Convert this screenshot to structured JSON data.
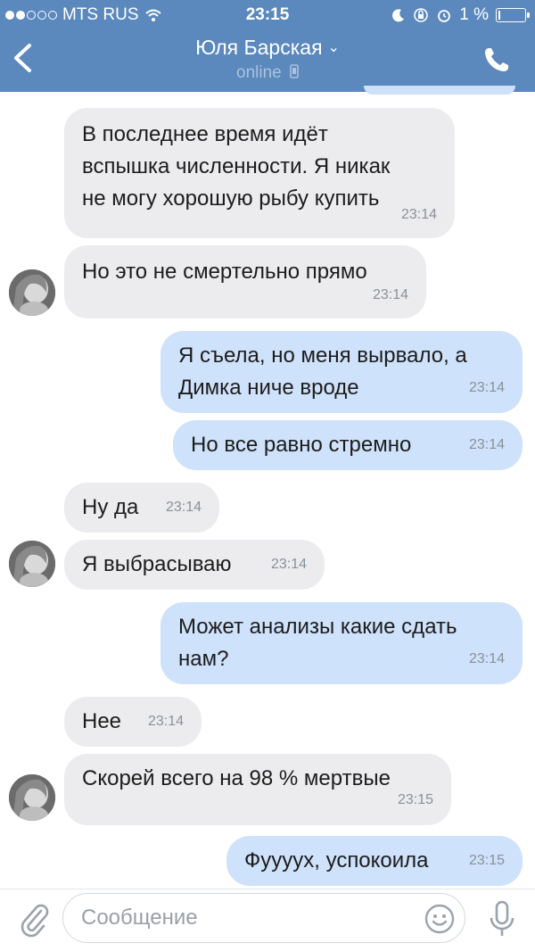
{
  "status_bar": {
    "carrier": "MTS RUS",
    "time": "23:15",
    "battery_text": "1 %"
  },
  "header": {
    "contact_name": "Юля Барская",
    "status": "online"
  },
  "messages": [
    {
      "dir": "in",
      "lines": [
        "В последнее время идёт",
        "вспышка численности. Я никак",
        "не могу хорошую рыбу купить"
      ],
      "time": "23:14",
      "avatar": false
    },
    {
      "dir": "in",
      "lines": [
        "Но это не смертельно прямо"
      ],
      "time": "23:14",
      "avatar": true
    },
    {
      "dir": "out",
      "lines": [
        "Я съела, но меня вырвало, а",
        "Димка ниче вроде"
      ],
      "time": "23:14"
    },
    {
      "dir": "out",
      "lines": [
        "Но все равно стремно"
      ],
      "time": "23:14"
    },
    {
      "dir": "in",
      "lines": [
        "Ну да"
      ],
      "time": "23:14",
      "avatar": false
    },
    {
      "dir": "in",
      "lines": [
        "Я выбрасываю"
      ],
      "time": "23:14",
      "avatar": true
    },
    {
      "dir": "out",
      "lines": [
        "Может анализы какие сдать",
        "нам?"
      ],
      "time": "23:14"
    },
    {
      "dir": "in",
      "lines": [
        "Нее"
      ],
      "time": "23:14",
      "avatar": false
    },
    {
      "dir": "in",
      "lines": [
        "Скорей всего на 98 % мертвые"
      ],
      "time": "23:15",
      "avatar": true
    },
    {
      "dir": "out",
      "lines": [
        "Фуууух, успокоила"
      ],
      "time": "23:15"
    }
  ],
  "composer": {
    "placeholder": "Сообщение"
  },
  "colors": {
    "header_bg": "#5b88bd",
    "incoming_bubble": "#ececee",
    "outgoing_bubble": "#cfe2fb"
  }
}
